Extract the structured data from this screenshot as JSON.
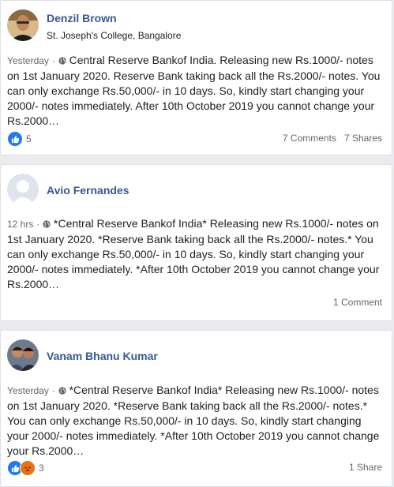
{
  "posts": [
    {
      "author": "Denzil Brown",
      "subtitle": "St. Joseph's College, Bangalore",
      "time": "Yesterday",
      "sep": "·",
      "text": "Central Reserve Bankof India. Releasing new Rs.1000/- notes on 1st January 2020. Reserve Bank taking back all the Rs.2000/- notes. You can only exchange Rs.50,000/- in 10 days. So, kindly start changing your 2000/- notes immediately. After 10th October 2019 you cannot change your Rs.2000…",
      "reactions": [
        "like-icon"
      ],
      "reaction_count": "5",
      "comments": "7 Comments",
      "shares": "7 Shares"
    },
    {
      "author": "Avio Fernandes",
      "time": "12 hrs",
      "sep": "·",
      "text": "*Central Reserve Bankof India* Releasing new Rs.1000/- notes on 1st January 2020. *Reserve Bank taking back all the Rs.2000/- notes.* You can only exchange Rs.50,000/- in 10 days. So, kindly start changing your 2000/- notes immediately. *After 10th October 2019 you cannot change your Rs.2000…",
      "comments": "1 Comment"
    },
    {
      "author": "Vanam Bhanu Kumar",
      "time": "Yesterday",
      "sep": "·",
      "text": "*Central Reserve Bankof India* Releasing new Rs.1000/- notes on 1st January 2020. *Reserve Bank taking back all the Rs.2000/- notes.* You can only exchange Rs.50,000/- in 10 days. So, kindly start changing your 2000/- notes immediately. *After 10th October 2019 you cannot change your Rs.2000…",
      "reactions": [
        "like-icon",
        "angry-icon"
      ],
      "reaction_count": "3",
      "shares": "1 Share"
    }
  ],
  "colors": {
    "link": "#365899",
    "like": "#2078f4",
    "angry": "#e9710f",
    "meta": "#606770"
  }
}
